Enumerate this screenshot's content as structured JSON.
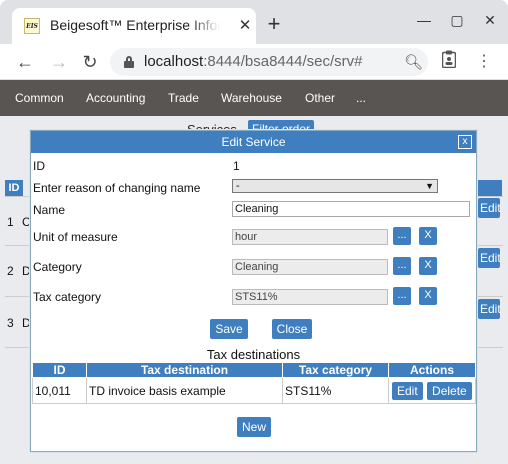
{
  "browser": {
    "tab_title": "Beigesoft™ Enterprise Information System",
    "tab_favicon_text": "EIS",
    "url_host": "localhost",
    "url_rest": ":8444/bsa8444/sec/srv#"
  },
  "menu": {
    "items": [
      "Common",
      "Accounting",
      "Trade",
      "Warehouse",
      "Other",
      "..."
    ]
  },
  "background": {
    "title": "Services",
    "filter_label": "Filter order",
    "id_header": "ID",
    "rows": [
      {
        "id": "1",
        "prefix": "C"
      },
      {
        "id": "2",
        "prefix": "D"
      },
      {
        "id": "3",
        "prefix": "D"
      }
    ],
    "edit_label": "Edit"
  },
  "dialog": {
    "title": "Edit Service",
    "close_label": "x",
    "id_label": "ID",
    "id_value": "1",
    "reason_label": "Enter reason of changing name",
    "reason_value": "-",
    "name_label": "Name",
    "name_value": "Cleaning",
    "uom_label": "Unit of measure",
    "uom_value": "hour",
    "category_label": "Category",
    "category_value": "Cleaning",
    "taxcat_label": "Tax category",
    "taxcat_value": "STS11%",
    "pick_label": "...",
    "clear_label": "X",
    "save_label": "Save",
    "close_button_label": "Close",
    "tax_dest_title": "Tax destinations",
    "table_headers": [
      "ID",
      "Tax destination",
      "Tax category",
      "Actions"
    ],
    "table_rows": [
      {
        "id": "10,011",
        "destination": "TD invoice basis example",
        "category": "STS11%"
      }
    ],
    "edit_label": "Edit",
    "delete_label": "Delete",
    "new_label": "New"
  },
  "colors": {
    "accent": "#3f7fbf",
    "menubar": "#595552"
  }
}
